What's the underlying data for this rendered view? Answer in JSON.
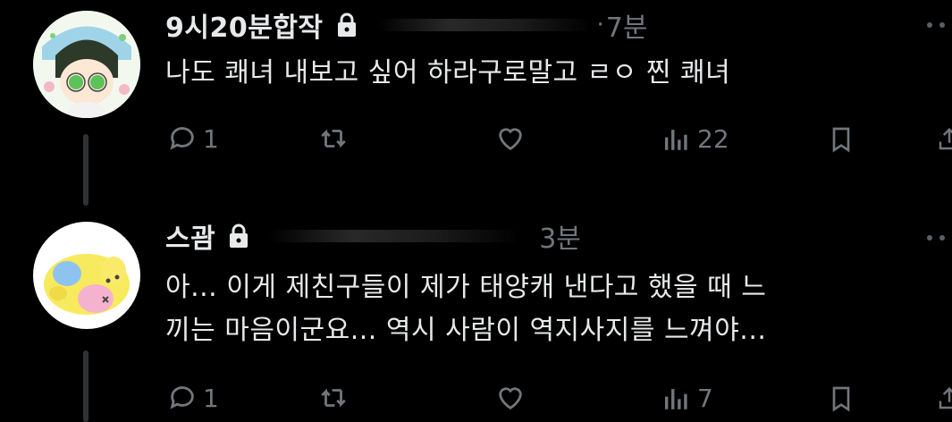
{
  "posts": [
    {
      "author": "9시20분합작",
      "time": "7분",
      "separator": "·",
      "text": "나도 쾌녀 내보고 싶어 하라구로말고 ㄹㅇ 찐 쾌녀",
      "replies": "1",
      "retweets": "",
      "likes": "",
      "views": "22"
    },
    {
      "author": "스괌",
      "time": "3분",
      "separator": "",
      "text": "아... 이게 제친구들이 제가 태양캐 낸다고 했을 때 느\n끼는 마음이군요... 역시 사람이 역지사지를 느껴야...",
      "replies": "1",
      "retweets": "",
      "likes": "",
      "views": "7"
    }
  ],
  "colors": {
    "background": "#000000",
    "text": "#e7e9ea",
    "muted": "#71767b"
  },
  "icons": [
    "lock-icon",
    "reply-icon",
    "retweet-icon",
    "like-icon",
    "views-icon",
    "bookmark-icon",
    "share-icon",
    "more-icon"
  ]
}
